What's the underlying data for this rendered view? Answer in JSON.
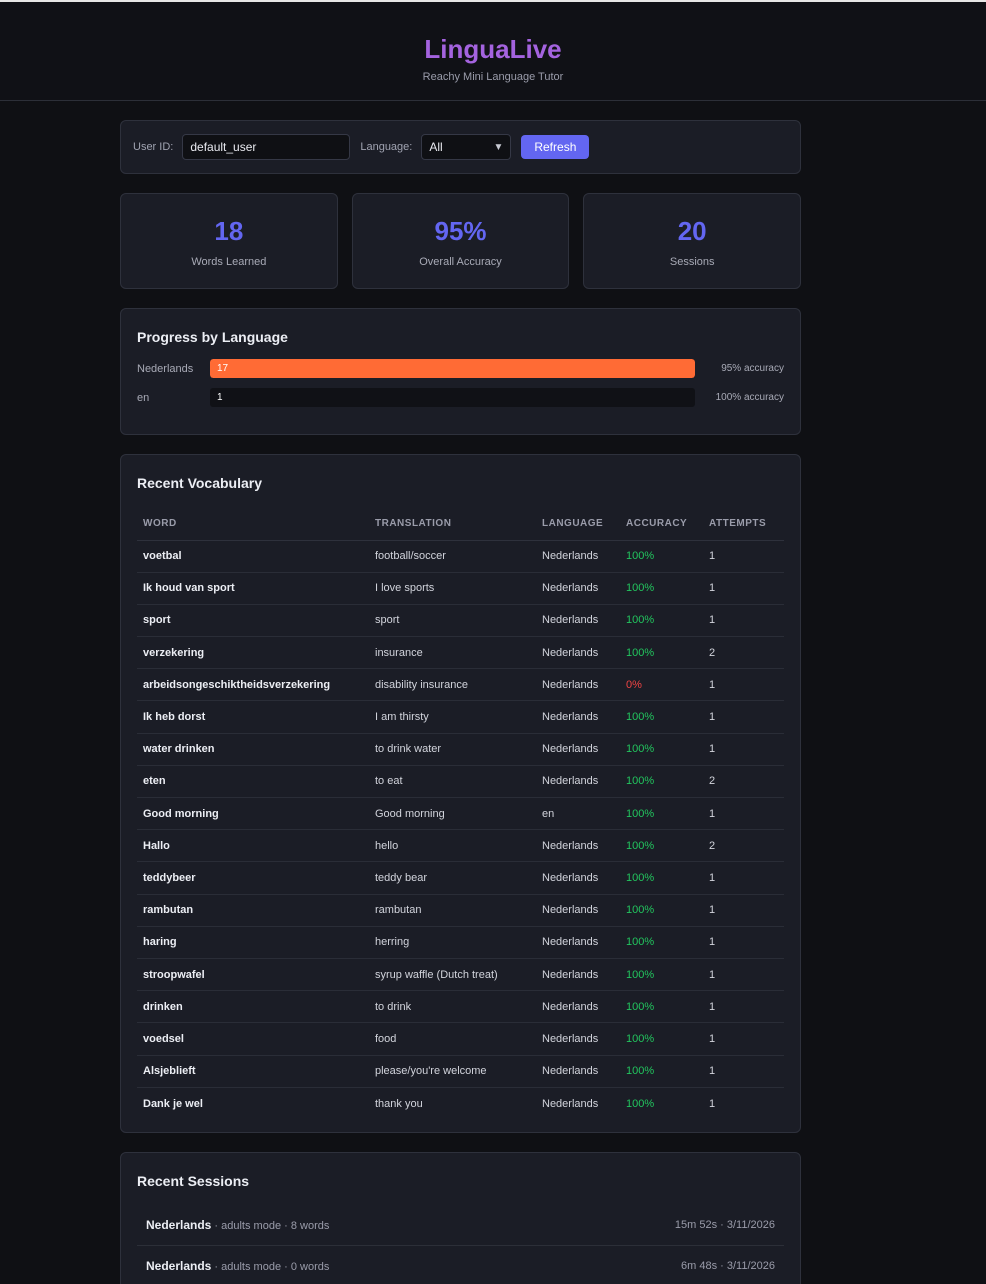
{
  "header": {
    "title": "LinguaLive",
    "subtitle": "Reachy Mini Language Tutor"
  },
  "controls": {
    "user_id_label": "User ID:",
    "user_id_value": "default_user",
    "language_label": "Language:",
    "language_value": "All",
    "refresh_label": "Refresh"
  },
  "stats": [
    {
      "value": "18",
      "label": "Words Learned"
    },
    {
      "value": "95%",
      "label": "Overall Accuracy"
    },
    {
      "value": "20",
      "label": "Sessions"
    }
  ],
  "progress": {
    "title": "Progress by Language",
    "rows": [
      {
        "language": "Nederlands",
        "count": "17",
        "fill_fraction": 1.0,
        "color": "#ff6b35",
        "accuracy": "95% accuracy"
      },
      {
        "language": "en",
        "count": "1",
        "fill_fraction": 0.0,
        "color": "#ff6b35",
        "accuracy": "100% accuracy"
      }
    ]
  },
  "vocabulary": {
    "title": "Recent Vocabulary",
    "columns": [
      "WORD",
      "TRANSLATION",
      "LANGUAGE",
      "ACCURACY",
      "ATTEMPTS"
    ],
    "colors": {
      "good": "#22c55e",
      "bad": "#ef4444"
    },
    "rows": [
      {
        "word": "voetbal",
        "translation": "football/soccer",
        "language": "Nederlands",
        "accuracy": "100%",
        "attempts": "1"
      },
      {
        "word": "Ik houd van sport",
        "translation": "I love sports",
        "language": "Nederlands",
        "accuracy": "100%",
        "attempts": "1"
      },
      {
        "word": "sport",
        "translation": "sport",
        "language": "Nederlands",
        "accuracy": "100%",
        "attempts": "1"
      },
      {
        "word": "verzekering",
        "translation": "insurance",
        "language": "Nederlands",
        "accuracy": "100%",
        "attempts": "2"
      },
      {
        "word": "arbeidsongeschiktheidsverzekering",
        "translation": "disability insurance",
        "language": "Nederlands",
        "accuracy": "0%",
        "attempts": "1"
      },
      {
        "word": "Ik heb dorst",
        "translation": "I am thirsty",
        "language": "Nederlands",
        "accuracy": "100%",
        "attempts": "1"
      },
      {
        "word": "water drinken",
        "translation": "to drink water",
        "language": "Nederlands",
        "accuracy": "100%",
        "attempts": "1"
      },
      {
        "word": "eten",
        "translation": "to eat",
        "language": "Nederlands",
        "accuracy": "100%",
        "attempts": "2"
      },
      {
        "word": "Good morning",
        "translation": "Good morning",
        "language": "en",
        "accuracy": "100%",
        "attempts": "1"
      },
      {
        "word": "Hallo",
        "translation": "hello",
        "language": "Nederlands",
        "accuracy": "100%",
        "attempts": "2"
      },
      {
        "word": "teddybeer",
        "translation": "teddy bear",
        "language": "Nederlands",
        "accuracy": "100%",
        "attempts": "1"
      },
      {
        "word": "rambutan",
        "translation": "rambutan",
        "language": "Nederlands",
        "accuracy": "100%",
        "attempts": "1"
      },
      {
        "word": "haring",
        "translation": "herring",
        "language": "Nederlands",
        "accuracy": "100%",
        "attempts": "1"
      },
      {
        "word": "stroopwafel",
        "translation": "syrup waffle (Dutch treat)",
        "language": "Nederlands",
        "accuracy": "100%",
        "attempts": "1"
      },
      {
        "word": "drinken",
        "translation": "to drink",
        "language": "Nederlands",
        "accuracy": "100%",
        "attempts": "1"
      },
      {
        "word": "voedsel",
        "translation": "food",
        "language": "Nederlands",
        "accuracy": "100%",
        "attempts": "1"
      },
      {
        "word": "Alsjeblieft",
        "translation": "please/you're welcome",
        "language": "Nederlands",
        "accuracy": "100%",
        "attempts": "1"
      },
      {
        "word": "Dank je wel",
        "translation": "thank you",
        "language": "Nederlands",
        "accuracy": "100%",
        "attempts": "1"
      }
    ]
  },
  "sessions": {
    "title": "Recent Sessions",
    "rows": [
      {
        "language": "Nederlands",
        "meta": " · adults mode · 8 words",
        "duration_date": "15m 52s · 3/11/2026"
      },
      {
        "language": "Nederlands",
        "meta": " · adults mode · 0 words",
        "duration_date": "6m 48s · 3/11/2026"
      }
    ]
  }
}
